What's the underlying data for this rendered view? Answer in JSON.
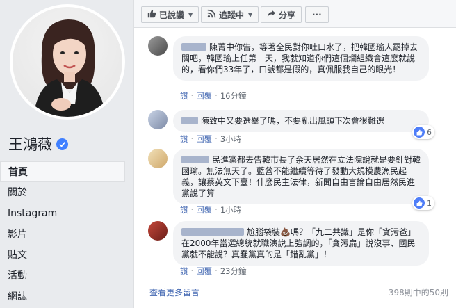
{
  "page": {
    "name": "王鴻薇",
    "verified": true
  },
  "nav": {
    "items": [
      {
        "label": "首頁",
        "active": true
      },
      {
        "label": "關於"
      },
      {
        "label": "Instagram"
      },
      {
        "label": "影片"
      },
      {
        "label": "貼文"
      },
      {
        "label": "活動"
      },
      {
        "label": "網誌"
      }
    ]
  },
  "actions": {
    "liked_label": "已說讚",
    "following_label": "追蹤中",
    "share_label": "分享",
    "more_label": "···"
  },
  "comments": [
    {
      "text": "陳菁中你告，等著全民對你吐口水了，把韓國瑜人罷掉去關吧，韓國瑜上任第一天，我就知道你們這個爛組織會這麼就說的，看你們33年了，口號都是假的，真佩服我自己的眼光！",
      "like_action": "讚",
      "reply_action": "回覆",
      "time": "16分鐘"
    },
    {
      "text": "陳致中又要選舉了嗎，不要亂出風頭下次會很難選",
      "like_action": "讚",
      "reply_action": "回覆",
      "time": "3小時",
      "reactions": "6"
    },
    {
      "text": "民進黨都去告韓市長了余天居然在立法院說就是要針對韓國瑜。無法無天了。藍營不能繼續等待了發動大規模農漁民起義，讓蔡英文下臺！什麼民主法律，新聞自由言論自由居然民進黨說了算",
      "like_action": "讚",
      "reply_action": "回覆",
      "time": "1小時",
      "reactions": "1"
    },
    {
      "text": "尬腦袋裝💩嗎？「九二共識」是你「貪污爸」在2000年當選總統就職演說上強調的，「貪污扁」說沒事、國民黨就不能說？真蠢黨真的是「錯亂黨」！",
      "like_action": "讚",
      "reply_action": "回覆",
      "time": "23分鐘"
    }
  ],
  "footer": {
    "more_comments": "查看更多留言",
    "counter": "398則中的50則"
  },
  "colors": {
    "link": "#4267b2",
    "bubble": "#f2f3f5",
    "like_blue": "#4f7ef8"
  }
}
